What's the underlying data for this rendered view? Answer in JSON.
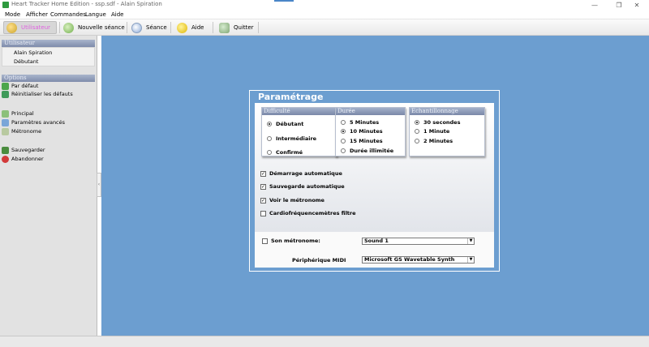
{
  "window": {
    "title": "Heart Tracker Home Edition - ssp.sdf - Alain Spiration",
    "minimize": "—",
    "maximize": "❐",
    "close": "✕"
  },
  "menu": [
    "Mode",
    "Afficher",
    "Commandes",
    "Langue",
    "Aide"
  ],
  "toolbar": {
    "active_label": "Utilisateur",
    "new_session": "Nouvelle séance",
    "session": "Séance",
    "help": "Aide",
    "quit": "Quitter"
  },
  "sidebar": {
    "user_header": "Utilisateur",
    "user_name": "Alain Spiration",
    "user_level": "Débutant",
    "options_header": "Options",
    "items": [
      {
        "label": "Par défaut",
        "icon": "flag-icon"
      },
      {
        "label": "Réinitialiser les défauts",
        "icon": "flag-reset-icon"
      },
      {
        "label": "Principal",
        "icon": "sliders-icon"
      },
      {
        "label": "Paramètres avancés",
        "icon": "wrench-icon"
      },
      {
        "label": "Métronome",
        "icon": "metronome-icon"
      },
      {
        "label": "Sauvegarder",
        "icon": "save-icon"
      },
      {
        "label": "Abandonner",
        "icon": "cancel-icon"
      }
    ]
  },
  "dialog": {
    "title": "Paramétrage",
    "difficulty": {
      "header": "Difficulté",
      "options": [
        "Débutant",
        "Intermédiaire",
        "Confirmé"
      ],
      "selected": 0
    },
    "duration": {
      "header": "Durée",
      "options": [
        "5 Minutes",
        "10 Minutes",
        "15 Minutes",
        "Durée illimitée"
      ],
      "selected": 1
    },
    "sampling": {
      "header": "Echantillonnage",
      "options": [
        "30 secondes",
        "1 Minute",
        "2 Minutes"
      ],
      "selected": 0
    },
    "checkboxes": [
      {
        "label": "Démarrage automatique",
        "checked": true
      },
      {
        "label": "Sauvegarde automatique",
        "checked": true
      },
      {
        "label": "Voir le métronome",
        "checked": true
      },
      {
        "label": "Cardiofréquencemètres filtre",
        "checked": false
      }
    ],
    "metronome_sound": {
      "label": "Son métronome:",
      "checked": false,
      "value": "Sound 1"
    },
    "midi": {
      "label": "Périphérique MIDI",
      "value": "Microsoft GS Wavetable Synth"
    }
  },
  "colors": {
    "background": "#6c9ed0",
    "group_header": "#7f8cab",
    "active_text": "#e060e0"
  }
}
